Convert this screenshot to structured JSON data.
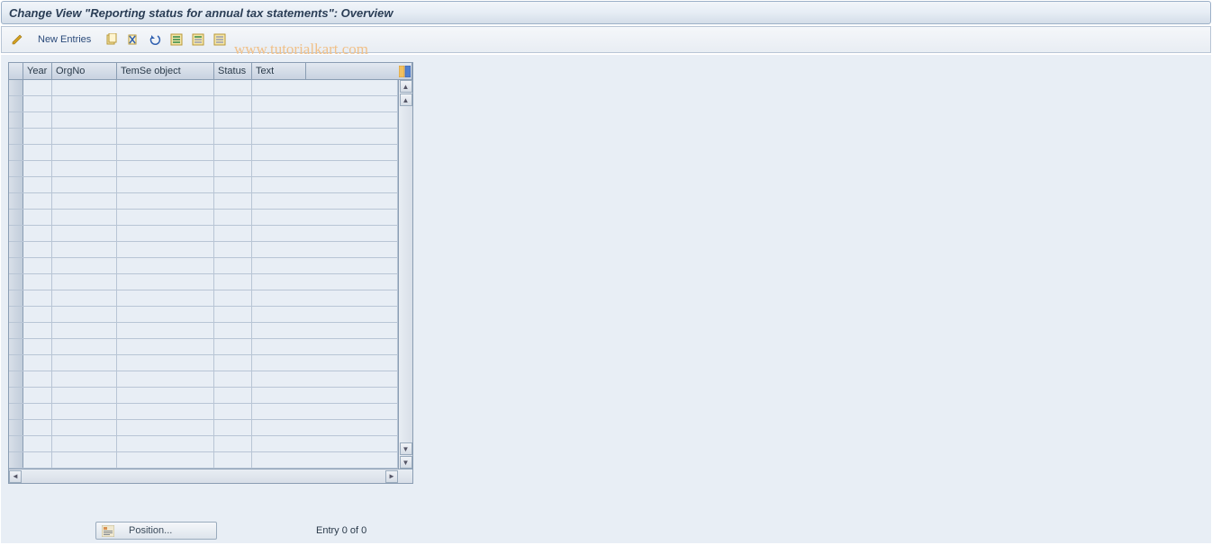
{
  "header": {
    "title": "Change View \"Reporting status for annual tax statements\": Overview"
  },
  "toolbar": {
    "new_entries_label": "New Entries",
    "icons": {
      "edit": "edit-icon",
      "copy": "copy-icon",
      "delete": "delete-icon",
      "undo": "undo-icon",
      "select_all": "select-all-icon",
      "select_block": "select-block-icon",
      "deselect_all": "deselect-all-icon"
    }
  },
  "table": {
    "columns": {
      "year": "Year",
      "orgno": "OrgNo",
      "temse": "TemSe object",
      "status": "Status",
      "text": "Text"
    },
    "row_count": 24,
    "rows": []
  },
  "footer": {
    "position_label": "Position...",
    "entry_status": "Entry 0 of 0"
  },
  "watermark": "www.tutorialkart.com"
}
